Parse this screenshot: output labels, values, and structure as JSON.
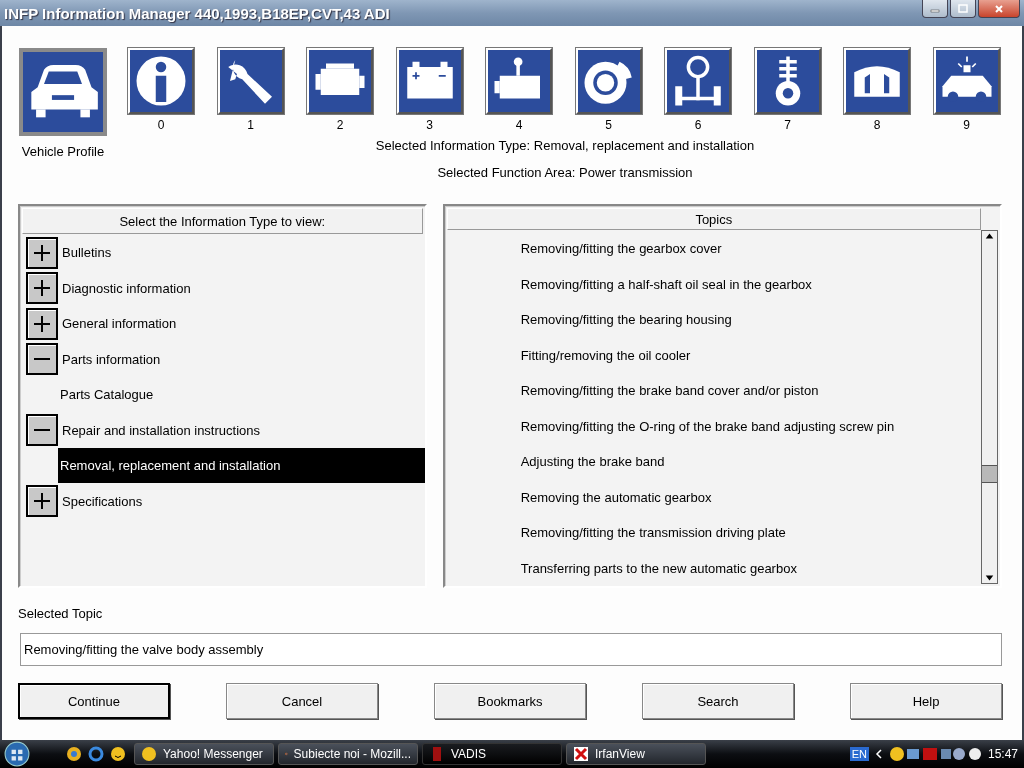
{
  "window": {
    "title": "INFP Information Manager 440,1993,B18EP,CVT,43 ADI"
  },
  "toolbar": {
    "vehicle_profile": {
      "label": "Vehicle Profile"
    },
    "function_groups": [
      {
        "label": "0"
      },
      {
        "label": "1"
      },
      {
        "label": "2"
      },
      {
        "label": "3"
      },
      {
        "label": "4"
      },
      {
        "label": "5"
      },
      {
        "label": "6"
      },
      {
        "label": "7"
      },
      {
        "label": "8"
      },
      {
        "label": "9"
      }
    ]
  },
  "selection_info": {
    "information_type": "Selected Information Type: Removal, replacement and installation",
    "function_area": "Selected Function Area: Power transmission"
  },
  "information_types": {
    "header": "Select the Information Type to view:",
    "items": [
      {
        "kind": "folder",
        "label": "Bulletins",
        "expanded": false,
        "selected": false
      },
      {
        "kind": "folder",
        "label": "Diagnostic information",
        "expanded": false,
        "selected": false
      },
      {
        "kind": "folder",
        "label": "General information",
        "expanded": false,
        "selected": false
      },
      {
        "kind": "folder",
        "label": "Parts information",
        "expanded": true,
        "selected": false,
        "children": [
          {
            "kind": "leaf",
            "label": "Parts Catalogue",
            "selected": false
          }
        ]
      },
      {
        "kind": "folder",
        "label": "Repair and installation instructions",
        "expanded": true,
        "selected": false,
        "children": [
          {
            "kind": "leaf",
            "label": "Removal, replacement and installation",
            "selected": true
          }
        ]
      },
      {
        "kind": "folder",
        "label": "Specifications",
        "expanded": false,
        "selected": false
      }
    ]
  },
  "topics": {
    "header": "Topics",
    "items": [
      "Removing/fitting the gearbox cover",
      "Removing/fitting a half-shaft oil seal in the gearbox",
      "Removing/fitting the bearing housing",
      "Fitting/removing the oil cooler",
      "Removing/fitting the brake band cover and/or piston",
      "Removing/fitting the O-ring of the brake band adjusting screw pin",
      "Adjusting the brake band",
      "Removing the automatic gearbox",
      "Removing/fitting the transmission driving plate",
      "Transferring parts to the new automatic gearbox"
    ]
  },
  "selected_topic": {
    "label": "Selected Topic",
    "value": "Removing/fitting the valve body assembly"
  },
  "buttons": [
    {
      "label": "Continue",
      "default": true
    },
    {
      "label": "Cancel",
      "default": false
    },
    {
      "label": "Bookmarks",
      "default": false
    },
    {
      "label": "Search",
      "default": false
    },
    {
      "label": "Help",
      "default": false
    }
  ],
  "taskbar": {
    "tasks": [
      {
        "label": "Yahoo! Messenger",
        "selected": false
      },
      {
        "label": "Subiecte noi - Mozill...",
        "selected": false
      },
      {
        "label": "VADIS",
        "selected": true
      },
      {
        "label": "IrfanView",
        "selected": false
      }
    ],
    "language": "EN",
    "clock": "15:47"
  }
}
